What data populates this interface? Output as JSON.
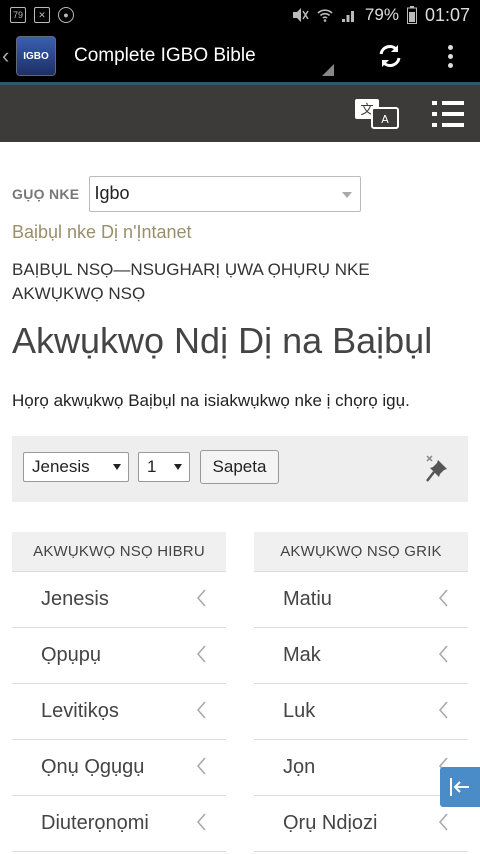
{
  "status_bar": {
    "left_icons": [
      "notification-icon-1",
      "notification-icon-2",
      "notification-icon-3"
    ],
    "battery": "79%",
    "time": "01:07"
  },
  "app_bar": {
    "title": "Complete IGBO Bible",
    "logo_text": "IGBO",
    "refresh_icon": "refresh-icon",
    "menu_icon": "overflow-menu-icon"
  },
  "site_header": {
    "translate_icon": "translate-icon",
    "menu_icon": "hamburger-menu-icon"
  },
  "language": {
    "label": "GỤỌ NKE",
    "selected": "Igbo"
  },
  "online_link": "Baịbụl nke Dị n'Ịntanet",
  "section_kicker": "BAỊBỤL NSỌ—NSUGHARỊ ỤWA ỌHỤRỤ NKE AKWỤKWỌ NSỌ",
  "page_title": "Akwụkwọ Ndị Dị na Baịbụl",
  "intro": "Họrọ akwụkwọ Baịbụl na isiakwụkwọ nke ị chọrọ igụ.",
  "navigator": {
    "book_selected": "Jenesis",
    "chapter_selected": "1",
    "go_label": "Sapeta",
    "pin_icon": "pin-icon"
  },
  "hebrew": {
    "header": "AKWỤKWỌ NSỌ HIBRU",
    "books": [
      "Jenesis",
      "Ọpụpụ",
      "Levitikọs",
      "Ọnụ Ọgụgụ",
      "Diuterọnọmi"
    ]
  },
  "greek": {
    "header": "AKWỤKWỌ NSỌ GRIK",
    "books": [
      "Matiu",
      "Mak",
      "Luk",
      "Jọn",
      "Ọrụ Ndịozi"
    ]
  },
  "colors": {
    "status_bg": "#000000",
    "header_bg": "#3d3b39",
    "accent_line": "#2f5a6a",
    "link": "#9a8f6a",
    "float_button": "#4a8cc7"
  }
}
